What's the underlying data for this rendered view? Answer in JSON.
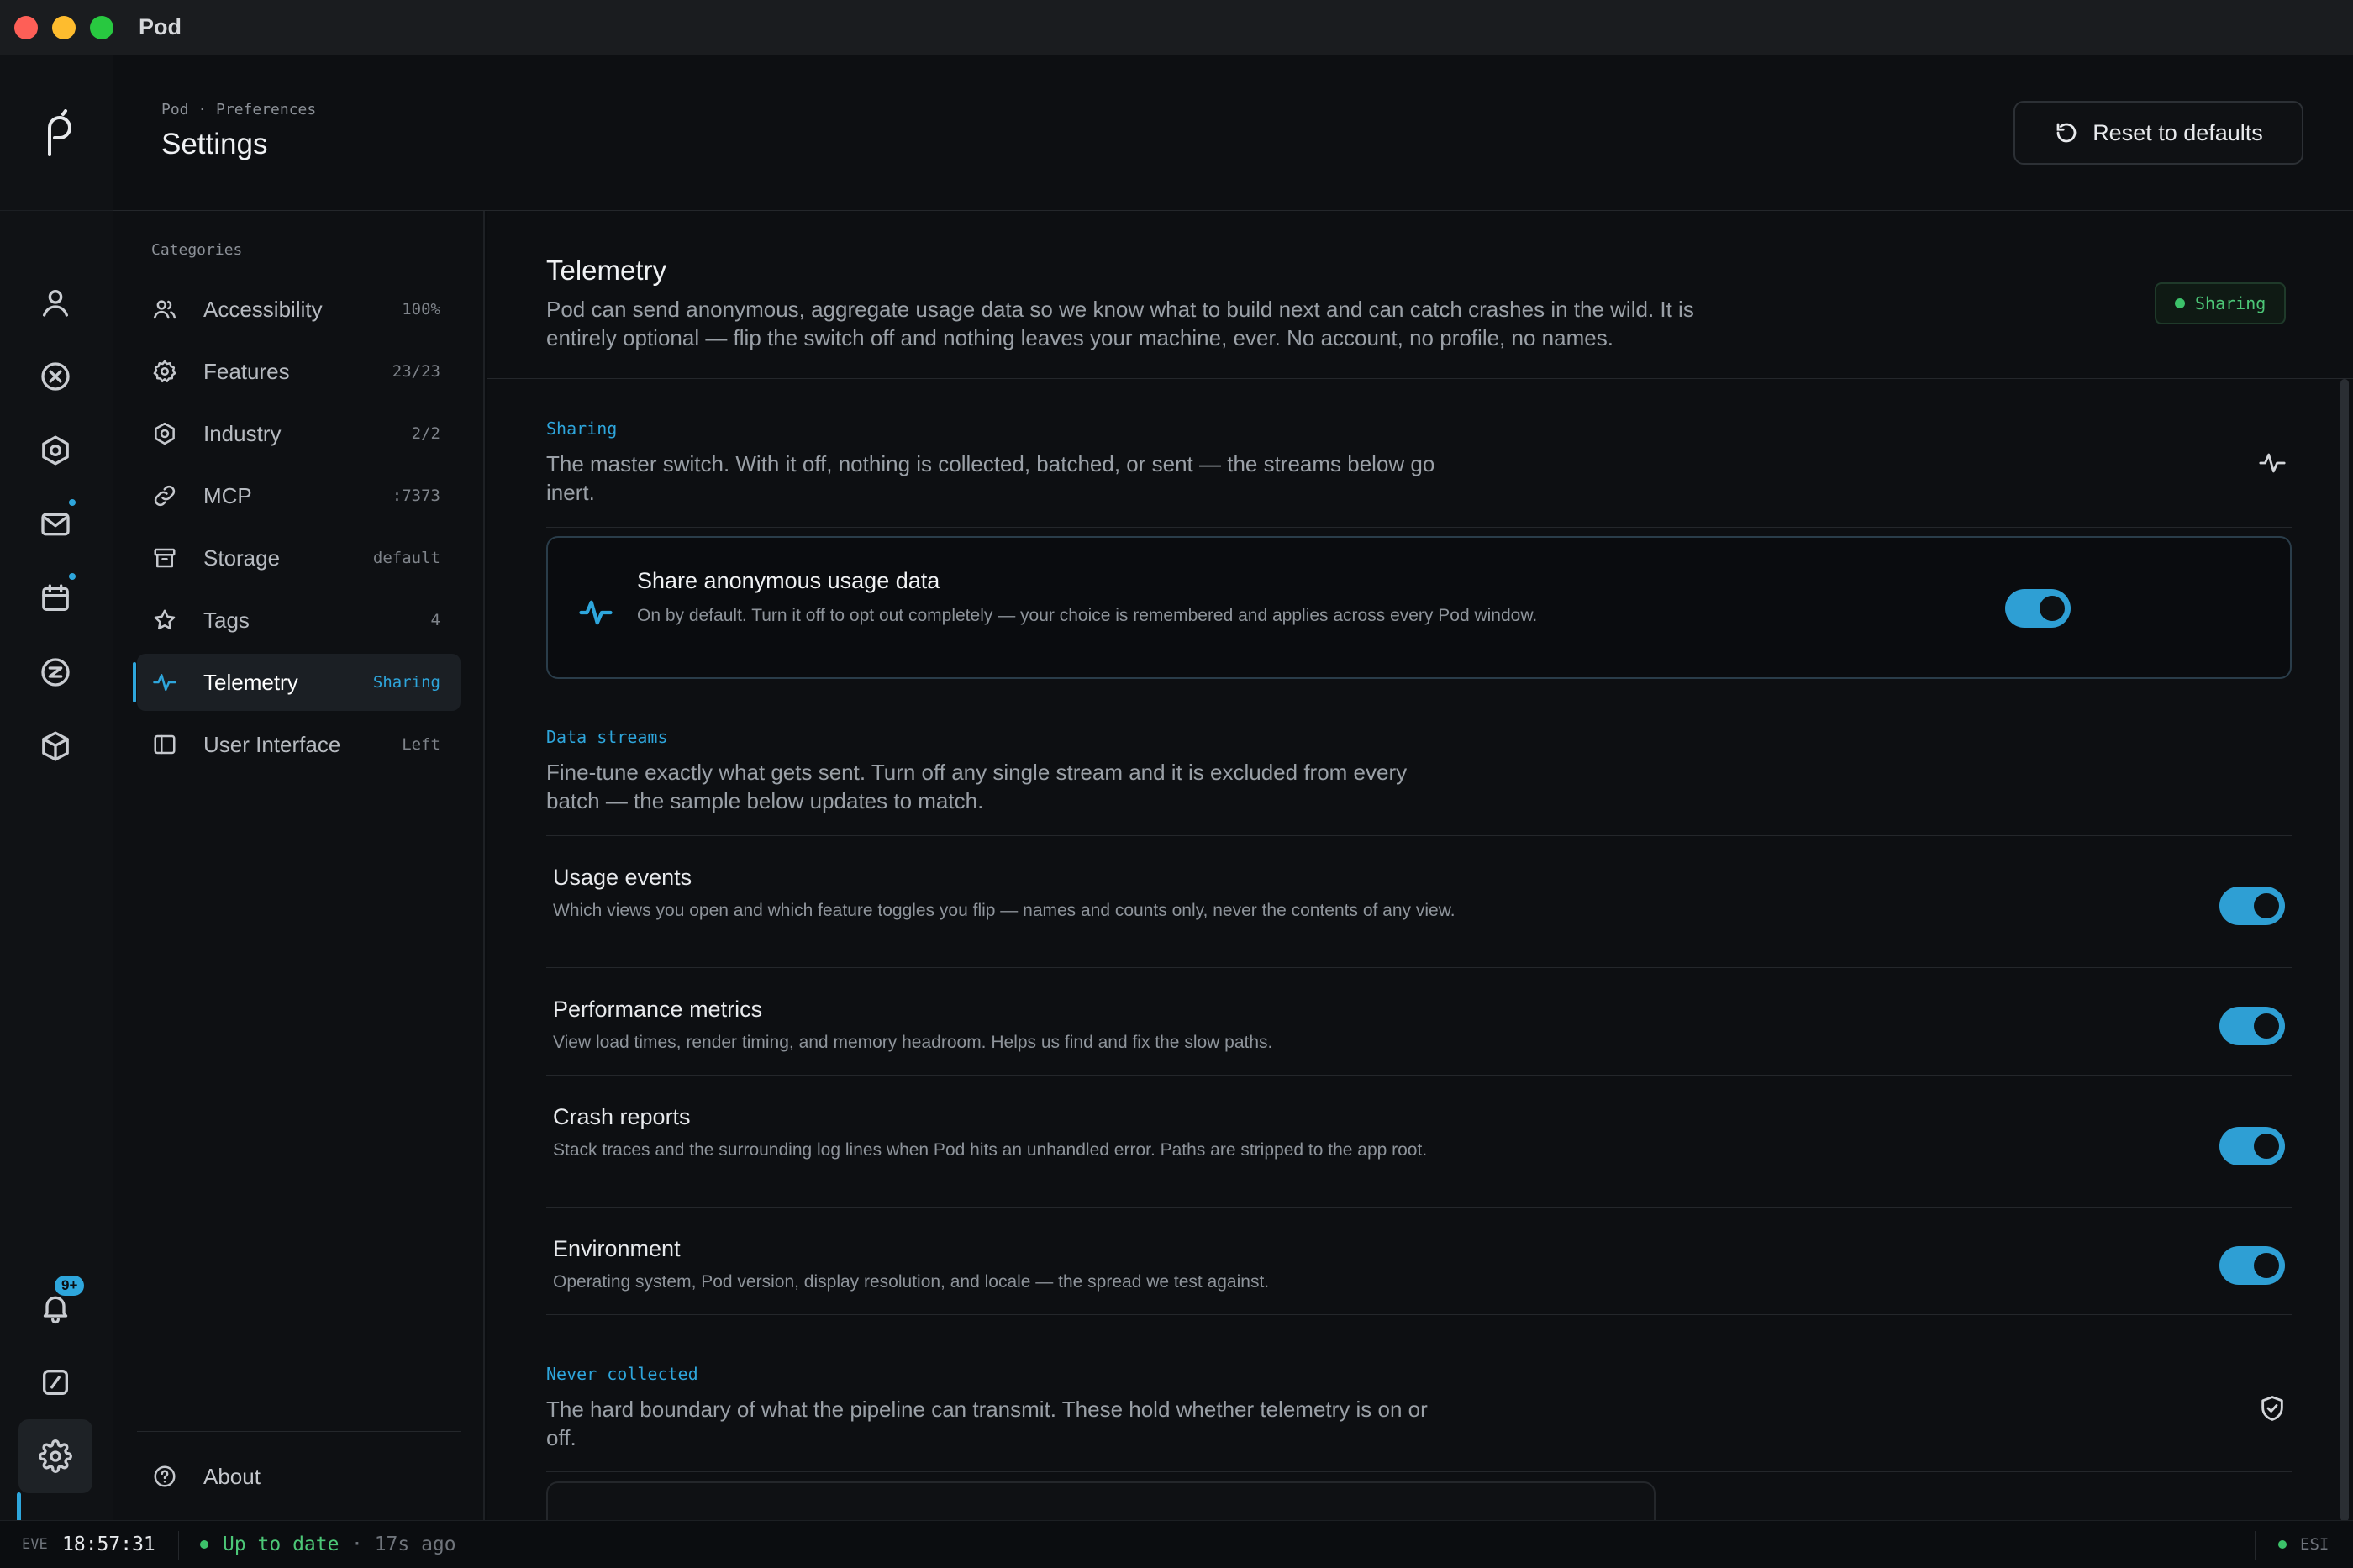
{
  "window": {
    "title": "Pod"
  },
  "header": {
    "breadcrumb": "Pod · Preferences",
    "title": "Settings",
    "reset_label": "Reset to defaults"
  },
  "rail": {
    "icons": [
      "pod-logo-icon",
      "user-icon",
      "circle-x-icon",
      "hexagon-icon",
      "mail-icon",
      "calendar-icon",
      "z-circle-icon",
      "cube-icon",
      "bell-icon",
      "slash-square-icon",
      "gear-icon"
    ],
    "notification_badge": "9+"
  },
  "categories": {
    "heading": "Categories",
    "items": [
      {
        "label": "Accessibility",
        "meta": "100%"
      },
      {
        "label": "Features",
        "meta": "23/23"
      },
      {
        "label": "Industry",
        "meta": "2/2"
      },
      {
        "label": "MCP",
        "meta": ":7373"
      },
      {
        "label": "Storage",
        "meta": "default"
      },
      {
        "label": "Tags",
        "meta": "4"
      },
      {
        "label": "Telemetry",
        "meta": "Sharing",
        "active": true
      },
      {
        "label": "User Interface",
        "meta": "Left"
      }
    ],
    "about": "About"
  },
  "telemetry": {
    "title": "Telemetry",
    "description": "Pod can send anonymous, aggregate usage data so we know what to build next and can catch crashes in the wild. It is entirely optional — flip the switch off and nothing leaves your machine, ever. No account, no profile, no names.",
    "status_pill": "Sharing",
    "sharing": {
      "label": "Sharing",
      "description": "The master switch. With it off, nothing is collected, batched, or sent — the streams below go inert.",
      "card_title": "Share anonymous usage data",
      "card_description": "On by default. Turn it off to opt out completely — your choice is remembered and applies across every Pod window.",
      "enabled": true
    },
    "streams": {
      "label": "Data streams",
      "description": "Fine-tune exactly what gets sent. Turn off any single stream and it is excluded from every batch — the sample below updates to match.",
      "items": [
        {
          "title": "Usage events",
          "description": "Which views you open and which feature toggles you flip — names and counts only, never the contents of any view.",
          "enabled": true
        },
        {
          "title": "Performance metrics",
          "description": "View load times, render timing, and memory headroom. Helps us find and fix the slow paths.",
          "enabled": true
        },
        {
          "title": "Crash reports",
          "description": "Stack traces and the surrounding log lines when Pod hits an unhandled error. Paths are stripped to the app root.",
          "enabled": true
        },
        {
          "title": "Environment",
          "description": "Operating system, Pod version, display resolution, and locale — the spread we test against.",
          "enabled": true
        }
      ]
    },
    "never": {
      "label": "Never collected",
      "description": "The hard boundary of what the pipeline can transmit. These hold whether telemetry is on or off."
    }
  },
  "statusbar": {
    "zone": "EVE",
    "time": "18:57:31",
    "status": "Up to date",
    "ago": "· 17s ago",
    "right": "ESI"
  },
  "colors": {
    "accent": "#2ea6dc",
    "ok": "#3cc26a",
    "background": "#0d0f12"
  }
}
